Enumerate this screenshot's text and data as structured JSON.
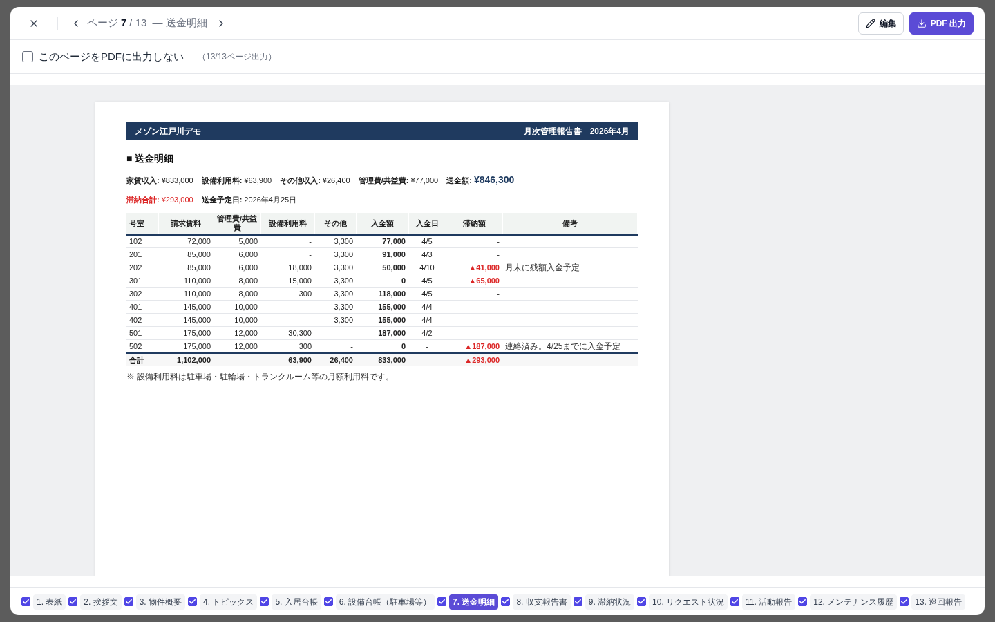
{
  "pager": {
    "label": "ページ",
    "current": "7",
    "total": "/ 13",
    "title": "— 送金明細"
  },
  "actions": [
    {
      "label": "編集",
      "kind": "edit"
    },
    {
      "label": "PDF 出力",
      "kind": "export"
    }
  ],
  "exclude_option": {
    "label": "このページをPDFに出力しない",
    "checked": false,
    "note": "（13/13ページ出力）"
  },
  "document": {
    "company": "メゾン江戸川デモ",
    "report": "月次管理報告書　2026年4月",
    "section_title": "■ 送金明細",
    "summary": [
      [
        {
          "kind": "plain",
          "label": "家賃収入:",
          "value": "¥833,000"
        },
        {
          "kind": "plain",
          "label": "設備利用料:",
          "value": "¥63,900"
        },
        {
          "kind": "plain",
          "label": "その他収入:",
          "value": "¥26,400"
        },
        {
          "kind": "plain",
          "label": "管理費/共益費:",
          "value": "¥77,000"
        },
        {
          "kind": "remit",
          "label": "送金額:",
          "value": "¥846,300"
        }
      ],
      [
        {
          "kind": "alert",
          "label": "滞納合計:",
          "value": "¥293,000"
        },
        {
          "kind": "plain",
          "label": "送金予定日:",
          "value": "2026年4月25日"
        }
      ]
    ],
    "table": {
      "columns": [
        "号室",
        "請求賃料",
        "管理費/共益費",
        "設備利用料",
        "その他",
        "入金額",
        "入金日",
        "滞納額",
        "備考"
      ],
      "rows": [
        {
          "room": "102",
          "rent": "72,000",
          "fee": "5,000",
          "facility": "-",
          "other": "3,300",
          "paid": "77,000",
          "date": "4/5",
          "arrears": "-",
          "overdue": false
        },
        {
          "room": "201",
          "rent": "85,000",
          "fee": "6,000",
          "facility": "-",
          "other": "3,300",
          "paid": "91,000",
          "date": "4/3",
          "arrears": "-",
          "overdue": false
        },
        {
          "room": "202",
          "rent": "85,000",
          "fee": "6,000",
          "facility": "18,000",
          "other": "3,300",
          "paid": "50,000",
          "date": "4/10",
          "arrears": "▲41,000",
          "note": "月末に残額入金予定",
          "overdue": true
        },
        {
          "room": "301",
          "rent": "110,000",
          "fee": "8,000",
          "facility": "15,000",
          "other": "3,300",
          "paid": "0",
          "date": "4/5",
          "arrears": "▲65,000",
          "overdue": true
        },
        {
          "room": "302",
          "rent": "110,000",
          "fee": "8,000",
          "facility": "300",
          "other": "3,300",
          "paid": "118,000",
          "date": "4/5",
          "arrears": "-",
          "overdue": false
        },
        {
          "room": "401",
          "rent": "145,000",
          "fee": "10,000",
          "facility": "-",
          "other": "3,300",
          "paid": "155,000",
          "date": "4/4",
          "arrears": "-",
          "overdue": false
        },
        {
          "room": "402",
          "rent": "145,000",
          "fee": "10,000",
          "facility": "-",
          "other": "3,300",
          "paid": "155,000",
          "date": "4/4",
          "arrears": "-",
          "overdue": false
        },
        {
          "room": "501",
          "rent": "175,000",
          "fee": "12,000",
          "facility": "30,300",
          "other": "-",
          "paid": "187,000",
          "date": "4/2",
          "arrears": "-",
          "overdue": false
        },
        {
          "room": "502",
          "rent": "175,000",
          "fee": "12,000",
          "facility": "300",
          "other": "-",
          "paid": "0",
          "date": "-",
          "arrears": "▲187,000",
          "note": "連絡済み。4/25までに入金予定",
          "overdue": true
        }
      ],
      "total": {
        "room": "合計",
        "rent": "1,102,000",
        "facility": "63,900",
        "other": "26,400",
        "paid": "833,000",
        "arrears": "▲293,000",
        "overdue": true
      }
    },
    "footnote": "※ 設備利用料は駐車場・駐輪場・トランクルーム等の月額利用料です。"
  },
  "pages": [
    {
      "label": "1. 表紙",
      "checked": true,
      "selected": false
    },
    {
      "label": "2. 挨拶文",
      "checked": true,
      "selected": false
    },
    {
      "label": "3. 物件概要",
      "checked": true,
      "selected": false
    },
    {
      "label": "4. トピックス",
      "checked": true,
      "selected": false
    },
    {
      "label": "5. 入居台帳",
      "checked": true,
      "selected": false
    },
    {
      "label": "6. 設備台帳（駐車場等）",
      "checked": true,
      "selected": false
    },
    {
      "label": "7. 送金明細",
      "checked": true,
      "selected": true
    },
    {
      "label": "8. 収支報告書",
      "checked": true,
      "selected": false
    },
    {
      "label": "9. 滞納状況",
      "checked": true,
      "selected": false
    },
    {
      "label": "10. リクエスト状況",
      "checked": true,
      "selected": false
    },
    {
      "label": "11. 活動報告",
      "checked": true,
      "selected": false
    },
    {
      "label": "12. メンテナンス履歴",
      "checked": true,
      "selected": false
    },
    {
      "label": "13. 巡回報告",
      "checked": true,
      "selected": false
    }
  ]
}
